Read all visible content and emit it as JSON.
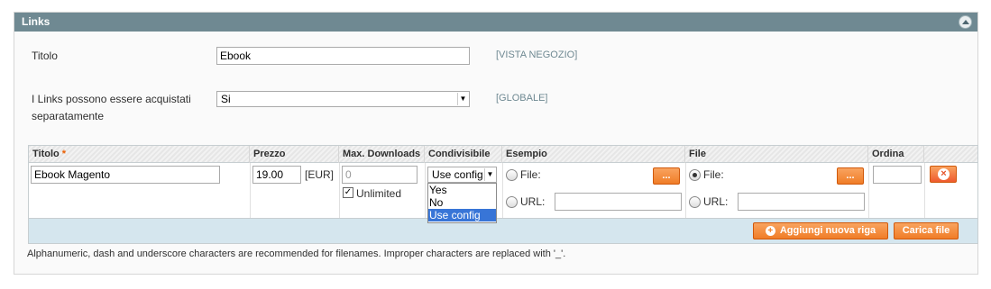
{
  "section": {
    "title": "Links"
  },
  "form": {
    "title_label": "Titolo",
    "title_value": "Ebook",
    "title_scope": "[VISTA NEGOZIO]",
    "separate_label_line1": "I Links possono essere acquistati",
    "separate_label_line2": "separatamente",
    "separate_value": "Si",
    "separate_scope": "[GLOBALE]"
  },
  "grid": {
    "headers": {
      "titolo": "Titolo",
      "required_mark": "*",
      "prezzo": "Prezzo",
      "max_downloads": "Max. Downloads",
      "condivisibile": "Condivisibile",
      "esempio": "Esempio",
      "file": "File",
      "ordina": "Ordina"
    },
    "row": {
      "title_value": "Ebook Magento",
      "price_value": "19.00",
      "currency": "[EUR]",
      "max_downloads_placeholder": "0",
      "unlimited_label": "Unlimited",
      "unlimited_checked": true,
      "shareable_value": "Use config",
      "sample_file_label": "File:",
      "sample_url_label": "URL:",
      "file_label": "File:",
      "url_label": "URL:",
      "browse_label": "...",
      "sort_order_value": ""
    },
    "shareable_options": [
      "Yes",
      "No",
      "Use config"
    ],
    "shareable_selected": "Use config",
    "add_row_label": "Aggiungi nuova riga",
    "upload_label": "Carica file"
  },
  "note": "Alphanumeric, dash and underscore characters are recommended for filenames. Improper characters are replaced with '_'.",
  "colors": {
    "header_bg": "#6f8992",
    "accent_orange": "#f07d27",
    "selected_option": "#3875d7"
  }
}
